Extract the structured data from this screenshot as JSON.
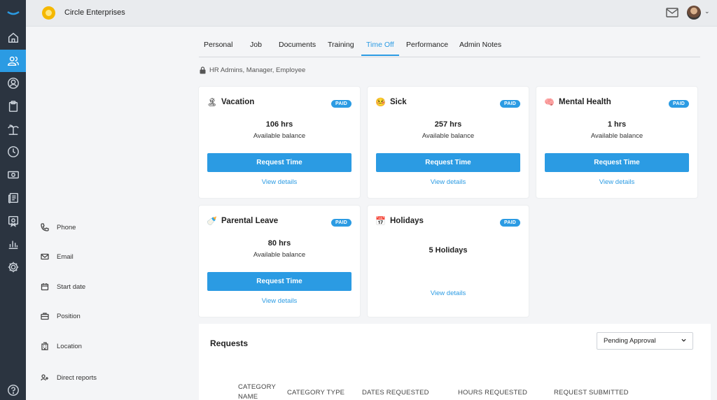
{
  "app": {
    "company_name": "Circle Enterprises"
  },
  "colors": {
    "accent": "#2b9be3",
    "rail": "#2b3440",
    "logo": "#f5b800"
  },
  "rail_icons": [
    "home-icon",
    "people-icon",
    "user-search-icon",
    "clipboard-icon",
    "island-icon",
    "clock-icon",
    "money-icon",
    "news-icon",
    "certificate-icon",
    "bar-chart-icon",
    "gear-icon",
    "help-icon"
  ],
  "profile_info": {
    "phone": "Phone",
    "email": "Email",
    "start_date": "Start date",
    "position": "Position",
    "location": "Location",
    "direct_reports": "Direct reports"
  },
  "tabs": [
    "Personal",
    "Job",
    "Documents",
    "Training",
    "Time Off",
    "Performance",
    "Admin Notes"
  ],
  "active_tab": "Time Off",
  "access_note": "HR Admins, Manager, Employee",
  "cards": [
    {
      "emoji": "🏝",
      "title": "Vacation",
      "badge": "PAID",
      "hours": "106 hrs",
      "label": "Available balance",
      "button": "Request Time",
      "link": "View details"
    },
    {
      "emoji": "🤒",
      "title": "Sick",
      "badge": "PAID",
      "hours": "257 hrs",
      "label": "Available balance",
      "button": "Request Time",
      "link": "View details"
    },
    {
      "emoji": "🧠",
      "title": "Mental Health",
      "badge": "PAID",
      "hours": "1 hrs",
      "label": "Available balance",
      "button": "Request Time",
      "link": "View details"
    },
    {
      "emoji": "🍼",
      "title": "Parental Leave",
      "badge": "PAID",
      "hours": "80 hrs",
      "label": "Available balance",
      "button": "Request Time",
      "link": "View details"
    },
    {
      "emoji": "📅",
      "title": "Holidays",
      "badge": "PAID",
      "hours": "5 Holidays",
      "link": "View details"
    }
  ],
  "requests": {
    "title": "Requests",
    "filter": "Pending Approval",
    "columns": [
      "CATEGORY NAME",
      "CATEGORY TYPE",
      "DATES REQUESTED",
      "HOURS REQUESTED",
      "REQUEST SUBMITTED"
    ]
  }
}
